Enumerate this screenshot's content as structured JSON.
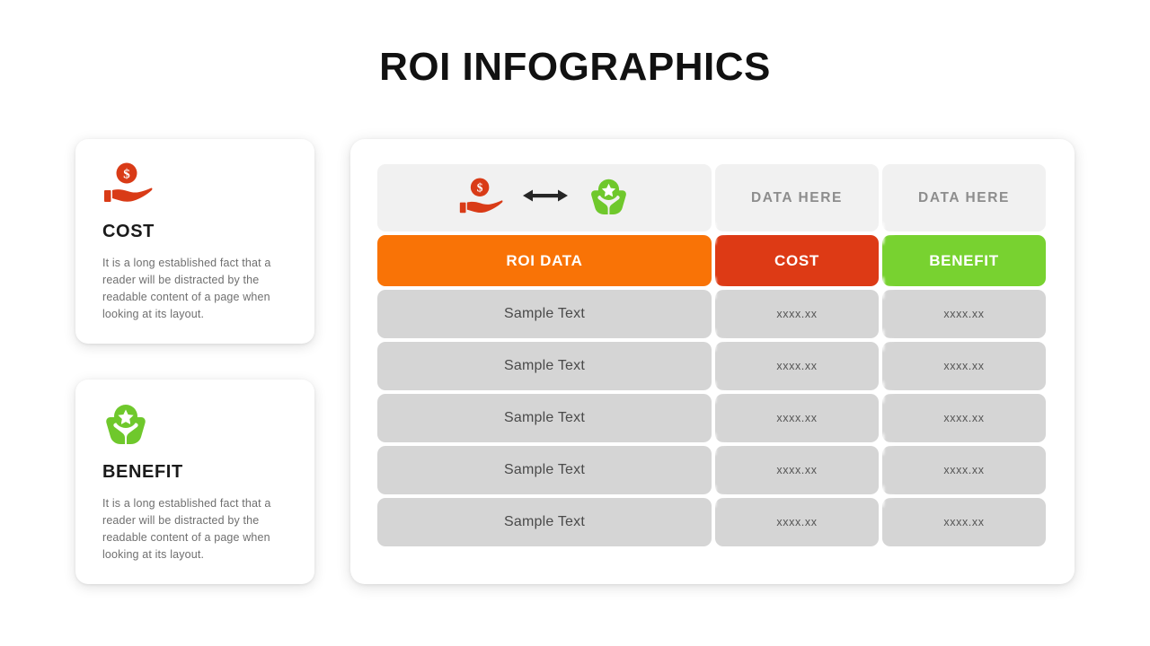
{
  "page": {
    "title": "ROI INFOGRAPHICS"
  },
  "cards": [
    {
      "id": "cost",
      "icon": "hand-holding-dollar-coin-icon",
      "heading": "COST",
      "body": "It is a long established fact that a reader will be distracted by the readable content of a page when looking at its layout."
    },
    {
      "id": "benefit",
      "icon": "hands-holding-star-badge-icon",
      "heading": "BENEFIT",
      "body": "It is a long established fact that a reader will be distracted by the readable content of a page when looking at its layout."
    }
  ],
  "table": {
    "header": {
      "icon_left": "hand-holding-dollar-coin-icon",
      "icon_middle": "double-arrow-icon",
      "icon_right": "hands-holding-star-badge-icon",
      "col2": "DATA HERE",
      "col3": "DATA HERE"
    },
    "column_bar": {
      "col1": "ROI DATA",
      "col2": "COST",
      "col3": "BENEFIT"
    },
    "rows": [
      {
        "label": "Sample Text",
        "cost": "xxxx.xx",
        "benefit": "xxxx.xx"
      },
      {
        "label": "Sample Text",
        "cost": "xxxx.xx",
        "benefit": "xxxx.xx"
      },
      {
        "label": "Sample Text",
        "cost": "xxxx.xx",
        "benefit": "xxxx.xx"
      },
      {
        "label": "Sample Text",
        "cost": "xxxx.xx",
        "benefit": "xxxx.xx"
      },
      {
        "label": "Sample Text",
        "cost": "xxxx.xx",
        "benefit": "xxxx.xx"
      }
    ]
  },
  "colors": {
    "cost_orange_red": "#dd3a15",
    "roi_orange": "#f97306",
    "benefit_green": "#78d230",
    "row_gray": "#d5d5d5",
    "header_gray": "#f1f1f1",
    "muted_text": "#8d8d8d"
  }
}
